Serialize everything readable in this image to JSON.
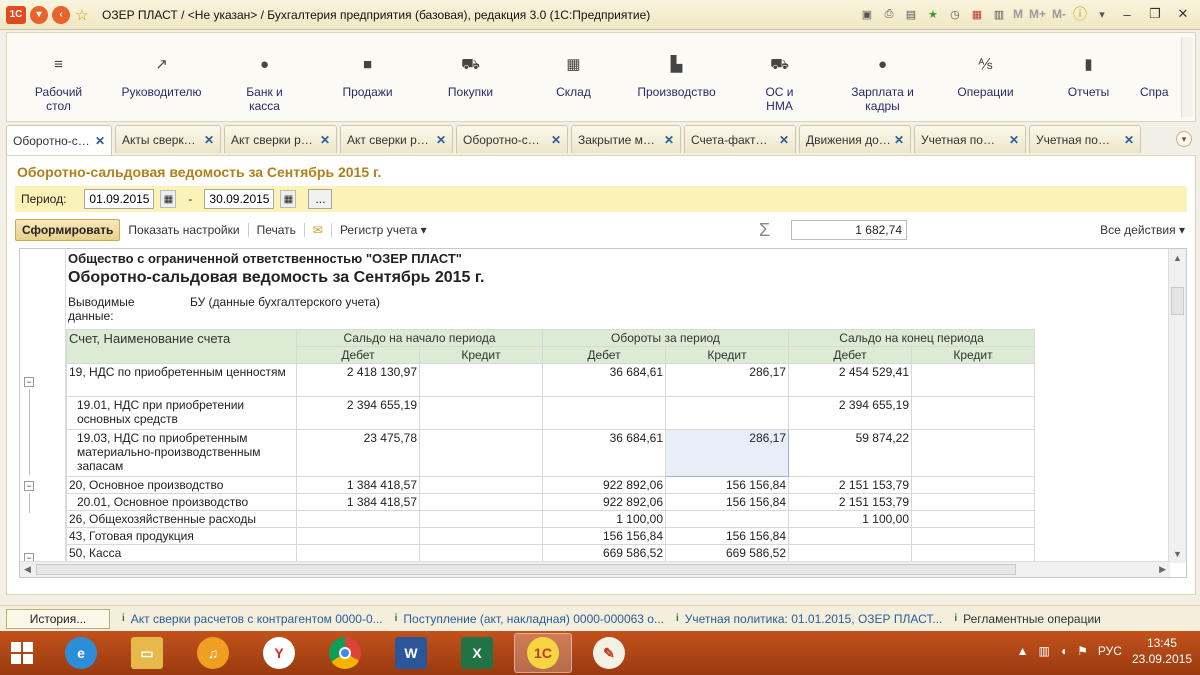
{
  "window": {
    "title": "ОЗЕР ПЛАСТ / <Не указан> / Бухгалтерия предприятия (базовая), редакция 3.0  (1С:Предприятие)",
    "memory_marks": [
      "M",
      "M+",
      "M-"
    ]
  },
  "sections": [
    {
      "label": "Рабочий стол",
      "icon": "menu-lines-icon"
    },
    {
      "label": "Руководителю",
      "icon": "trend-icon"
    },
    {
      "label": "Банк и касса",
      "icon": "coin-icon"
    },
    {
      "label": "Продажи",
      "icon": "bag-icon"
    },
    {
      "label": "Покупки",
      "icon": "cart-icon"
    },
    {
      "label": "Склад",
      "icon": "grid-icon"
    },
    {
      "label": "Производство",
      "icon": "factory-icon"
    },
    {
      "label": "ОС и НМА",
      "icon": "truck-icon"
    },
    {
      "label": "Зарплата и кадры",
      "icon": "person-icon"
    },
    {
      "label": "Операции",
      "icon": "operations-icon"
    },
    {
      "label": "Отчеты",
      "icon": "bar-chart-icon"
    },
    {
      "label": "Спра",
      "icon": ""
    }
  ],
  "tabs": [
    {
      "label": "Оборотно-с…",
      "active": true
    },
    {
      "label": "Акты сверк…"
    },
    {
      "label": "Акт сверки р…"
    },
    {
      "label": "Акт сверки р…"
    },
    {
      "label": "Оборотно-с…"
    },
    {
      "label": "Закрытие м…"
    },
    {
      "label": "Счета-факт…"
    },
    {
      "label": "Движения до…"
    },
    {
      "label": "Учетная по…"
    },
    {
      "label": "Учетная по…"
    }
  ],
  "form": {
    "title": "Оборотно-сальдовая ведомость за Сентябрь 2015 г.",
    "period_label": "Период:",
    "date_from": "01.09.2015",
    "date_dash": "-",
    "date_to": "30.09.2015",
    "dots": "...",
    "btn_generate": "Сформировать",
    "show_settings": "Показать настройки",
    "print": "Печать",
    "register": "Регистр учета ▾",
    "sum_value": "1 682,74",
    "all_actions": "Все действия ▾"
  },
  "report": {
    "org": "Общество с ограниченной ответственностью \"ОЗЕР ПЛАСТ\"",
    "title": "Оборотно-сальдовая ведомость за Сентябрь 2015 г.",
    "output_label": "Выводимые данные:",
    "output_value": "БУ (данные бухгалтерского учета)",
    "header": {
      "account": "Счет, Наименование счета",
      "opening": "Сальдо на начало периода",
      "turnover": "Обороты за период",
      "closing": "Сальдо на конец периода",
      "debit": "Дебет",
      "credit": "Кредит"
    },
    "rows": [
      {
        "account": "19, НДС по приобретенным ценностям",
        "od": "2 418 130,97",
        "oc": "",
        "td": "36 684,61",
        "tc": "286,17",
        "cd": "2 454 529,41",
        "cc": ""
      },
      {
        "account": "19.01, НДС при приобретении основных средств",
        "od": "2 394 655,19",
        "oc": "",
        "td": "",
        "tc": "",
        "cd": "2 394 655,19",
        "cc": ""
      },
      {
        "account": "19.03, НДС по приобретенным материально-производственным запасам",
        "od": "23 475,78",
        "oc": "",
        "td": "36 684,61",
        "tc": "286,17",
        "cd": "59 874,22",
        "cc": ""
      },
      {
        "account": "20, Основное производство",
        "od": "1 384 418,57",
        "oc": "",
        "td": "922 892,06",
        "tc": "156 156,84",
        "cd": "2 151 153,79",
        "cc": ""
      },
      {
        "account": "20.01, Основное производство",
        "od": "1 384 418,57",
        "oc": "",
        "td": "922 892,06",
        "tc": "156 156,84",
        "cd": "2 151 153,79",
        "cc": ""
      },
      {
        "account": "26, Общехозяйственные расходы",
        "od": "",
        "oc": "",
        "td": "1 100,00",
        "tc": "",
        "cd": "1 100,00",
        "cc": ""
      },
      {
        "account": "43, Готовая продукция",
        "od": "",
        "oc": "",
        "td": "156 156,84",
        "tc": "156 156,84",
        "cd": "",
        "cc": ""
      },
      {
        "account": "50, Касса",
        "od": "",
        "oc": "",
        "td": "669 586,52",
        "tc": "669 586,52",
        "cd": "",
        "cc": ""
      }
    ]
  },
  "history": {
    "button": "История...",
    "items": [
      "Акт сверки расчетов с контрагентом 0000-0...",
      "Поступление (акт, накладная) 0000-000063 о...",
      "Учетная политика: 01.01.2015, ОЗЕР ПЛАСТ...",
      "Регламентные операции"
    ]
  },
  "taskbar": {
    "lang": "РУС",
    "time": "13:45",
    "date": "23.09.2015",
    "onec_label": "1С"
  }
}
